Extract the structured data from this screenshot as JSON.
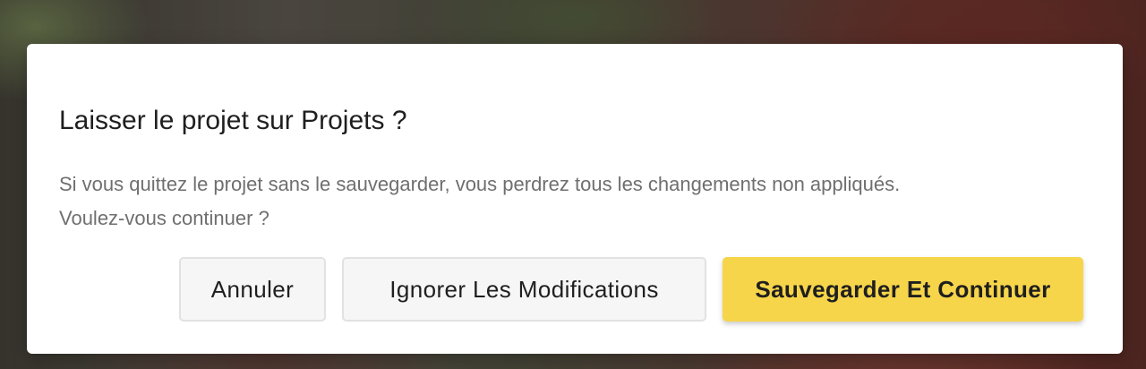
{
  "dialog": {
    "title": "Laisser le projet sur Projets ?",
    "message_line1": "Si vous quittez le projet sans le sauvegarder, vous perdrez tous les changements non appliqués.",
    "message_line2": "Voulez-vous continuer ?"
  },
  "actions": {
    "cancel_label": "Annuler",
    "ignore_label": "Ignorer Les Modifications",
    "save_label": "Sauvegarder Et Continuer"
  },
  "colors": {
    "primary_button": "#f7d54a",
    "secondary_button": "#f6f6f6",
    "title_text": "#1f1f1f",
    "body_text": "#6f6f6f"
  }
}
